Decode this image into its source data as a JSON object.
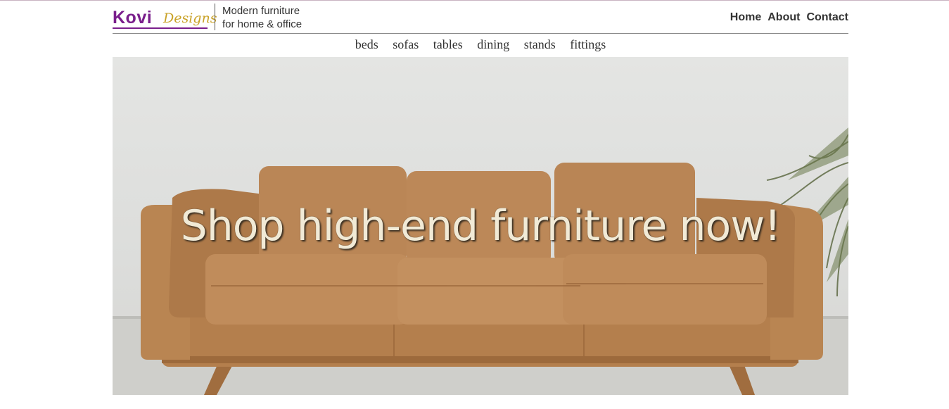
{
  "brand": {
    "name_main": "Kovi",
    "name_script": "Designs",
    "tagline_line1": "Modern furniture",
    "tagline_line2": "for home & office"
  },
  "top_nav": [
    {
      "label": "Home"
    },
    {
      "label": "About"
    },
    {
      "label": "Contact"
    }
  ],
  "categories": [
    {
      "label": "beds"
    },
    {
      "label": "sofas"
    },
    {
      "label": "tables"
    },
    {
      "label": "dining"
    },
    {
      "label": "stands"
    },
    {
      "label": "fittings"
    }
  ],
  "hero": {
    "title": "Shop high-end furniture now!"
  },
  "below_heading": "",
  "colors": {
    "brand_purple": "#7a1f8c",
    "brand_gold": "#c9a227",
    "sofa_leather": "#b98552",
    "hero_text": "#f1ead6"
  }
}
